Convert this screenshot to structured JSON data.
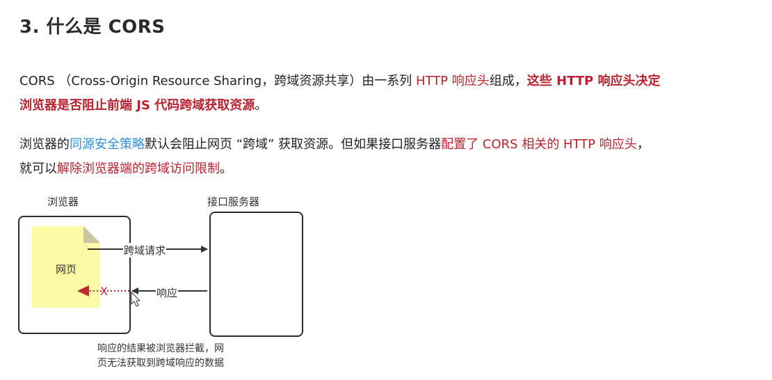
{
  "heading": "3. 什么是 CORS",
  "para1": {
    "t1": "CORS （Cross-Origin Resource Sharing，跨域资源共享）由一系列 ",
    "t2": "HTTP 响应头",
    "t3": "组成，",
    "t4": "这些 HTTP 响应头决定",
    "t5": "浏览器是否阻止前端 JS 代码跨域获取资源",
    "t6": "。"
  },
  "para2": {
    "t1": "浏览器的",
    "t2": "同源安全策略",
    "t3": "默认会阻止网页 “跨域” 获取资源。但如果接口服务器",
    "t4": "配置了 CORS 相关的 HTTP 响应头",
    "t5": "，",
    "t6": "就可以",
    "t7": "解除浏览器端的跨域访问限制",
    "t8": "。"
  },
  "diagram": {
    "browser_label": "浏览器",
    "server_label": "接口服务器",
    "webpage_label": "网页",
    "request_label": "跨域请求",
    "response_label": "响应",
    "blocked_mark": "X",
    "note_line1": "响应的结果被浏览器拦截，网",
    "note_line2": "页无法获取到跨域响应的数据"
  },
  "colors": {
    "accent_red": "#b8232f",
    "link_blue": "#2f8fd6",
    "note_yellow": "#fbf8a6"
  }
}
